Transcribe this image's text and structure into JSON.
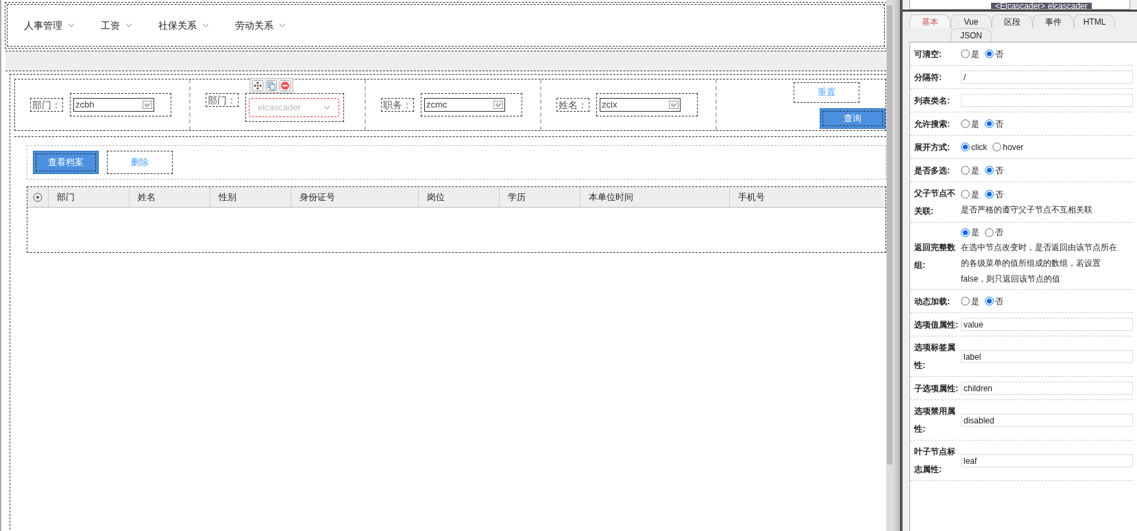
{
  "menu": [
    {
      "label": "人事管理"
    },
    {
      "label": "工资"
    },
    {
      "label": "社保关系"
    },
    {
      "label": "劳动关系"
    }
  ],
  "search_fields": [
    {
      "label": "部门：",
      "kind": "input",
      "value": "zcbh"
    },
    {
      "label": "部门：",
      "kind": "cascader",
      "placeholder": "elcascader",
      "selected": true
    },
    {
      "label": "职务：",
      "kind": "input",
      "value": "zcmc"
    },
    {
      "label": "姓名：",
      "kind": "input",
      "value": "zclx"
    }
  ],
  "search_buttons": [
    {
      "label": "重置",
      "kind": "plain"
    },
    {
      "label": "查询",
      "kind": "primary"
    }
  ],
  "toolbar_buttons": [
    {
      "label": "查看档案",
      "kind": "primary"
    },
    {
      "label": "删除",
      "kind": "plain"
    }
  ],
  "table": {
    "columns": [
      "部门",
      "姓名",
      "性别",
      "身份证号",
      "岗位",
      "学历",
      "本单位时间",
      "手机号"
    ]
  },
  "inspector": {
    "breadcrumb": "<Elcascader> elcascader",
    "tabs": [
      {
        "label": "基本",
        "selected": true
      },
      {
        "label": "Vue",
        "selected": false
      },
      {
        "label": "区段",
        "selected": false
      },
      {
        "label": "事件",
        "selected": false
      },
      {
        "label": "HTML",
        "selected": false
      },
      {
        "label": "JSON",
        "selected": false
      }
    ],
    "rows": [
      {
        "label": "可清空:",
        "kind": "radio",
        "options": [
          {
            "label": "是",
            "selected": false
          },
          {
            "label": "否",
            "selected": true
          }
        ]
      },
      {
        "label": "分隔符:",
        "kind": "text",
        "value": "/"
      },
      {
        "label": "列表类名:",
        "kind": "text"
      },
      {
        "label": "允许搜索:",
        "kind": "radio",
        "options": [
          {
            "label": "是",
            "selected": false
          },
          {
            "label": "否",
            "selected": true
          }
        ]
      },
      {
        "label": "展开方式:",
        "kind": "radio",
        "options": [
          {
            "label": "click",
            "selected": true
          },
          {
            "label": "hover",
            "selected": false
          }
        ]
      },
      {
        "label": "是否多选:",
        "kind": "radio",
        "options": [
          {
            "label": "是",
            "selected": false
          },
          {
            "label": "否",
            "selected": true
          }
        ]
      },
      {
        "label": "父子节点不关联:",
        "kind": "radio",
        "options": [
          {
            "label": "是",
            "selected": false
          },
          {
            "label": "否",
            "selected": true
          }
        ],
        "description": "是否严格的遵守父子节点不互相关联"
      },
      {
        "label": "返回完整数组:",
        "kind": "radio",
        "options": [
          {
            "label": "是",
            "selected": true
          },
          {
            "label": "否",
            "selected": false
          }
        ],
        "description": "在选中节点改变时，是否返回由该节点所在的各级菜单的值所组成的数组，若设置false，则只返回该节点的值"
      },
      {
        "label": "动态加载:",
        "kind": "radio",
        "options": [
          {
            "label": "是",
            "selected": false
          },
          {
            "label": "否",
            "selected": true
          }
        ]
      },
      {
        "label": "选项值属性:",
        "kind": "text",
        "value": "value"
      },
      {
        "label": "选项标签属性:",
        "kind": "text",
        "value": "label"
      },
      {
        "label": "子选项属性:",
        "kind": "text",
        "value": "children"
      },
      {
        "label": "选项禁用属性:",
        "kind": "text",
        "value": "disabled"
      },
      {
        "label": "叶子节点标志属性:",
        "kind": "text",
        "value": "leaf"
      }
    ]
  }
}
